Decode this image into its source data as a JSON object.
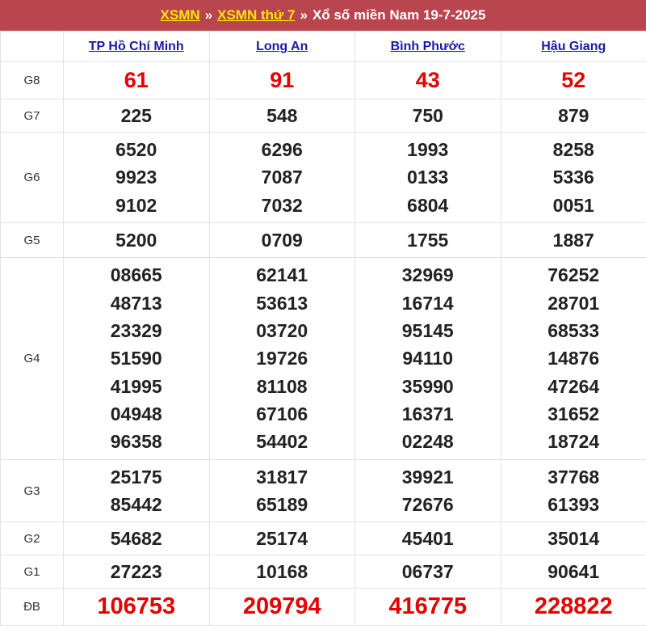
{
  "header": {
    "link1": "XSMN",
    "sep1": "»",
    "link2": "XSMN thứ 7",
    "sep2": "»",
    "title": "Xổ số miền Nam 19-7-2025"
  },
  "provinces": [
    "TP Hồ Chí Minh",
    "Long An",
    "Bình Phước",
    "Hậu Giang"
  ],
  "rows": [
    {
      "label": "G8",
      "values": [
        [
          "61"
        ],
        [
          "91"
        ],
        [
          "43"
        ],
        [
          "52"
        ]
      ]
    },
    {
      "label": "G7",
      "values": [
        [
          "225"
        ],
        [
          "548"
        ],
        [
          "750"
        ],
        [
          "879"
        ]
      ]
    },
    {
      "label": "G6",
      "values": [
        [
          "6520",
          "9923",
          "9102"
        ],
        [
          "6296",
          "7087",
          "7032"
        ],
        [
          "1993",
          "0133",
          "6804"
        ],
        [
          "8258",
          "5336",
          "0051"
        ]
      ]
    },
    {
      "label": "G5",
      "values": [
        [
          "5200"
        ],
        [
          "0709"
        ],
        [
          "1755"
        ],
        [
          "1887"
        ]
      ]
    },
    {
      "label": "G4",
      "values": [
        [
          "08665",
          "48713",
          "23329",
          "51590",
          "41995",
          "04948",
          "96358"
        ],
        [
          "62141",
          "53613",
          "03720",
          "19726",
          "81108",
          "67106",
          "54402"
        ],
        [
          "32969",
          "16714",
          "95145",
          "94110",
          "35990",
          "16371",
          "02248"
        ],
        [
          "76252",
          "28701",
          "68533",
          "14876",
          "47264",
          "31652",
          "18724"
        ]
      ]
    },
    {
      "label": "G3",
      "values": [
        [
          "25175",
          "85442"
        ],
        [
          "31817",
          "65189"
        ],
        [
          "39921",
          "72676"
        ],
        [
          "37768",
          "61393"
        ]
      ]
    },
    {
      "label": "G2",
      "values": [
        [
          "54682"
        ],
        [
          "25174"
        ],
        [
          "45401"
        ],
        [
          "35014"
        ]
      ]
    },
    {
      "label": "G1",
      "values": [
        [
          "27223"
        ],
        [
          "10168"
        ],
        [
          "06737"
        ],
        [
          "90641"
        ]
      ]
    },
    {
      "label": "ĐB",
      "values": [
        [
          "106753"
        ],
        [
          "209794"
        ],
        [
          "416775"
        ],
        [
          "228822"
        ]
      ]
    }
  ],
  "colors": {
    "header_bg": "#b9464f",
    "header_link": "#ffe400",
    "province_link": "#1a1aa8",
    "highlight_red": "#e60000"
  }
}
